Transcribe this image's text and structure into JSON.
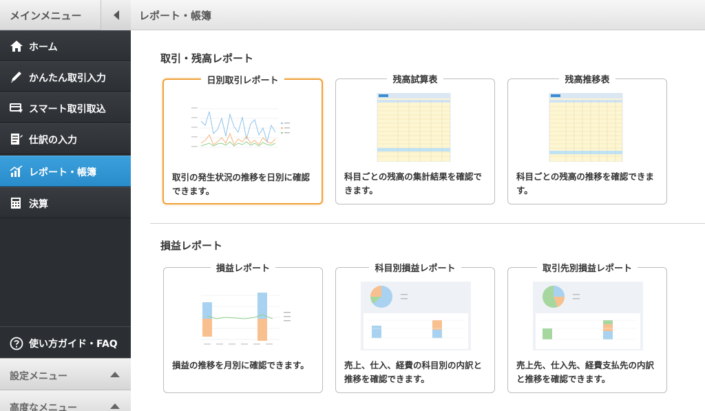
{
  "sidebar": {
    "header_title": "メインメニュー",
    "items": [
      {
        "label": "ホーム",
        "icon": "home-icon"
      },
      {
        "label": "かんたん取引入力",
        "icon": "pencil-icon"
      },
      {
        "label": "スマート取引取込",
        "icon": "card-import-icon"
      },
      {
        "label": "仕訳の入力",
        "icon": "journal-icon"
      },
      {
        "label": "レポート・帳簿",
        "icon": "report-chart-icon",
        "active": true
      },
      {
        "label": "決算",
        "icon": "calculator-icon"
      }
    ],
    "help": {
      "label": "使い方ガイド・FAQ",
      "icon": "question-icon"
    },
    "settings_menu": "設定メニュー",
    "advanced_menu": "高度なメニュー"
  },
  "topbar": {
    "title": "レポート・帳簿"
  },
  "sections": [
    {
      "title": "取引・残高レポート",
      "cards": [
        {
          "title": "日別取引レポート",
          "desc": "取引の発生状況の推移を日別に確認できます。",
          "selected": true
        },
        {
          "title": "残高試算表",
          "desc": "科目ごとの残高の集計結果を確認できます。"
        },
        {
          "title": "残高推移表",
          "desc": "科目ごとの残高の推移を確認できます。"
        }
      ]
    },
    {
      "title": "損益レポート",
      "cards": [
        {
          "title": "損益レポート",
          "desc": "損益の推移を月別に確認できます。"
        },
        {
          "title": "科目別損益レポート",
          "desc": "売上、仕入、経費の科目別の内訳と推移を確認できます。"
        },
        {
          "title": "取引先別損益レポート",
          "desc": "売上先、仕入先、経費支払先の内訳と推移を確認できます。"
        }
      ]
    }
  ],
  "colors": {
    "accent": "#2a8ccb",
    "selected_border": "#f0a23a",
    "sidebar_bg": "#2b2f33"
  }
}
